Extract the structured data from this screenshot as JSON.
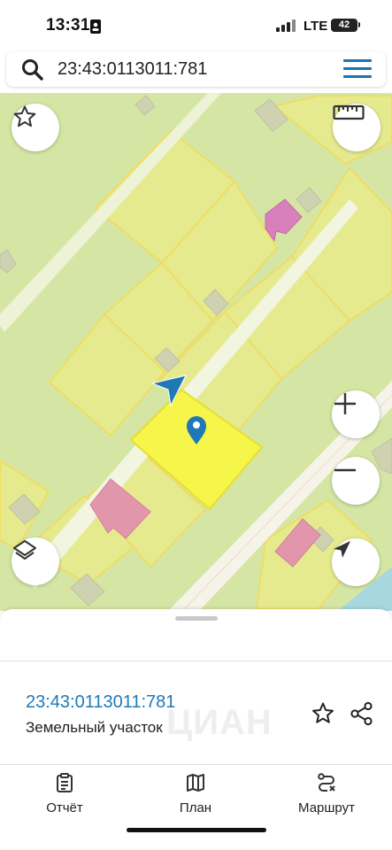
{
  "status_bar": {
    "time": "13:31",
    "network": "LTE",
    "battery": "42"
  },
  "search": {
    "query": "23:43:0113011:781",
    "search_icon": "search-icon",
    "menu_icon": "hamburger-menu-icon"
  },
  "map": {
    "controls": [
      "star-icon",
      "ruler-icon",
      "zoom-in-icon",
      "zoom-out-icon",
      "layers-icon",
      "location-arrow-icon"
    ],
    "colors": {
      "background": "#d5e6a4",
      "parcel_fill": "#e6ea8f",
      "parcel_border": "#eddd63",
      "selected_parcel": "#f6f54a",
      "building": "#e296ab",
      "building_dark": "#d97fbb",
      "marker": "#1f79b7",
      "road": "#f6f3e8",
      "water": "#a8d7e0"
    }
  },
  "sheet": {
    "cadastral_number": "23:43:0113011:781",
    "object_type": "Земельный участок",
    "watermark": "ЦИАН",
    "actions": [
      "star-icon",
      "share-icon"
    ],
    "tabs": [
      {
        "label": "Отчёт",
        "icon": "report-clipboard-icon"
      },
      {
        "label": "План",
        "icon": "map-plan-icon"
      },
      {
        "label": "Маршрут",
        "icon": "route-icon"
      }
    ]
  }
}
